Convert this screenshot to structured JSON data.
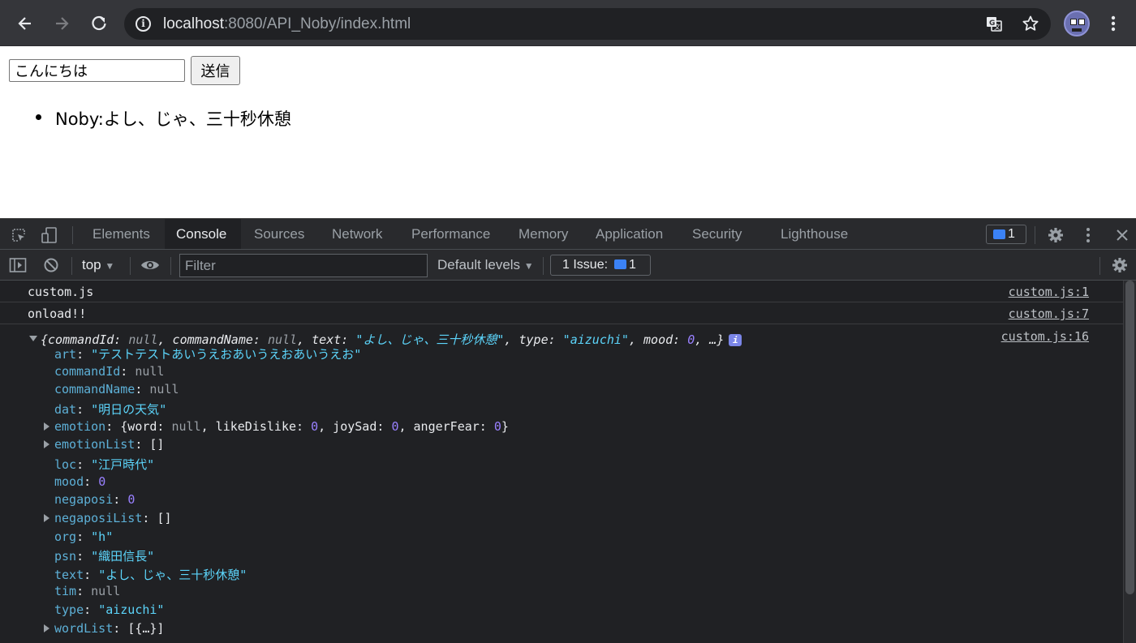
{
  "browser": {
    "url_host": "localhost",
    "url_rest": ":8080/API_Noby/index.html"
  },
  "page": {
    "input_value": "こんにちは",
    "send_label": "送信",
    "replies": [
      "Noby:よし、じゃ、三十秒休憩"
    ]
  },
  "devtools": {
    "tabs": [
      "Elements",
      "Console",
      "Sources",
      "Network",
      "Performance",
      "Memory",
      "Application",
      "Security",
      "Lighthouse"
    ],
    "active_tab": "Console",
    "issues_count": "1",
    "context": "top",
    "filter_placeholder": "Filter",
    "levels_label": "Default levels",
    "issue_label": "1 Issue:",
    "issue_count": "1"
  },
  "console": {
    "messages": [
      {
        "text": "custom.js",
        "source": "custom.js:1"
      },
      {
        "text": "onload!!",
        "source": "custom.js:7"
      }
    ],
    "object": {
      "source": "custom.js:16",
      "summary_parts": [
        {
          "k": "{commandId: ",
          "c": "plain"
        },
        {
          "k": "null",
          "c": "nul"
        },
        {
          "k": ", commandName: ",
          "c": "plain"
        },
        {
          "k": "null",
          "c": "nul"
        },
        {
          "k": ", text: ",
          "c": "plain"
        },
        {
          "k": "\"よし、じゃ、三十秒休憩\"",
          "c": "str"
        },
        {
          "k": ", type: ",
          "c": "plain"
        },
        {
          "k": "\"aizuchi\"",
          "c": "str"
        },
        {
          "k": ", mood: ",
          "c": "plain"
        },
        {
          "k": "0",
          "c": "num"
        },
        {
          "k": ", …}",
          "c": "plain"
        }
      ],
      "properties": [
        {
          "key": "art",
          "expand": false,
          "parts": [
            {
              "k": "\"テストテストあいうえおあいうえおあいうえお\"",
              "c": "str"
            }
          ]
        },
        {
          "key": "commandId",
          "expand": false,
          "parts": [
            {
              "k": "null",
              "c": "nul"
            }
          ]
        },
        {
          "key": "commandName",
          "expand": false,
          "parts": [
            {
              "k": "null",
              "c": "nul"
            }
          ]
        },
        {
          "key": "dat",
          "expand": false,
          "parts": [
            {
              "k": "\"明日の天気\"",
              "c": "str"
            }
          ]
        },
        {
          "key": "emotion",
          "expand": true,
          "parts": [
            {
              "k": "{word: ",
              "c": "plain"
            },
            {
              "k": "null",
              "c": "nul"
            },
            {
              "k": ", likeDislike: ",
              "c": "plain"
            },
            {
              "k": "0",
              "c": "num"
            },
            {
              "k": ", joySad: ",
              "c": "plain"
            },
            {
              "k": "0",
              "c": "num"
            },
            {
              "k": ", angerFear: ",
              "c": "plain"
            },
            {
              "k": "0",
              "c": "num"
            },
            {
              "k": "}",
              "c": "plain"
            }
          ]
        },
        {
          "key": "emotionList",
          "expand": true,
          "parts": [
            {
              "k": "[]",
              "c": "plain"
            }
          ]
        },
        {
          "key": "loc",
          "expand": false,
          "parts": [
            {
              "k": "\"江戸時代\"",
              "c": "str"
            }
          ]
        },
        {
          "key": "mood",
          "expand": false,
          "parts": [
            {
              "k": "0",
              "c": "num"
            }
          ]
        },
        {
          "key": "negaposi",
          "expand": false,
          "parts": [
            {
              "k": "0",
              "c": "num"
            }
          ]
        },
        {
          "key": "negaposiList",
          "expand": true,
          "parts": [
            {
              "k": "[]",
              "c": "plain"
            }
          ]
        },
        {
          "key": "org",
          "expand": false,
          "parts": [
            {
              "k": "\"h\"",
              "c": "str"
            }
          ]
        },
        {
          "key": "psn",
          "expand": false,
          "parts": [
            {
              "k": "\"織田信長\"",
              "c": "str"
            }
          ]
        },
        {
          "key": "text",
          "expand": false,
          "parts": [
            {
              "k": "\"よし、じゃ、三十秒休憩\"",
              "c": "str"
            }
          ]
        },
        {
          "key": "tim",
          "expand": false,
          "parts": [
            {
              "k": "null",
              "c": "nul"
            }
          ]
        },
        {
          "key": "type",
          "expand": false,
          "parts": [
            {
              "k": "\"aizuchi\"",
              "c": "str"
            }
          ]
        },
        {
          "key": "wordList",
          "expand": true,
          "parts": [
            {
              "k": "[{…}]",
              "c": "plain"
            }
          ]
        }
      ]
    }
  },
  "colors": {
    "toolbar_bg": "#35363a",
    "devtools_bg": "#202124",
    "string": "#5cd5fb",
    "number": "#9980ff",
    "key": "#5db0d7"
  }
}
